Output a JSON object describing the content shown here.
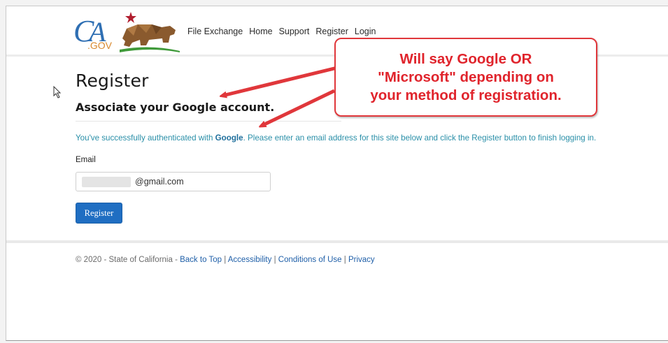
{
  "header": {
    "logo_text": "CA.GOV",
    "nav": [
      "File Exchange",
      "Home",
      "Support",
      "Register",
      "Login"
    ]
  },
  "page": {
    "title": "Register",
    "subtitle": "Associate your Google account.",
    "info_prefix": "You've successfully authenticated with ",
    "info_provider": "Google",
    "info_suffix": ". Please enter an email address for this site below and click the Register button to finish logging in."
  },
  "form": {
    "email_label": "Email",
    "email_value": "@gmail.com",
    "register_label": "Register"
  },
  "footer": {
    "copyright": "© 2020 - State of California - ",
    "links": [
      "Back to Top",
      "Accessibility",
      "Conditions of Use",
      "Privacy"
    ],
    "separator": " | "
  },
  "annotation": {
    "lines": [
      "Will say Google OR",
      "\"Microsoft\" depending on",
      "your method of registration."
    ],
    "color": "#e0242c"
  },
  "colors": {
    "link": "#1f5fa8",
    "info": "#2a8fa8",
    "button": "#1f6ec2"
  }
}
